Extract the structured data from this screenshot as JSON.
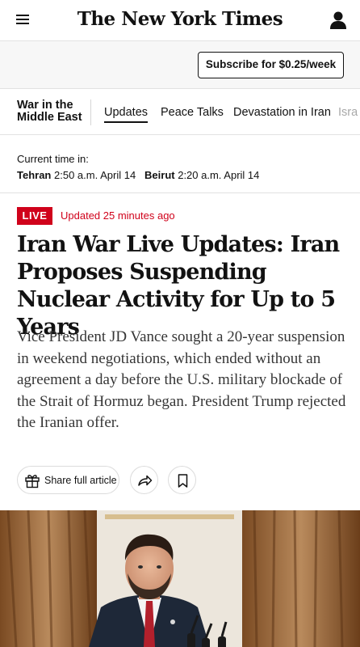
{
  "masthead": {
    "logo_text": "The New York Times",
    "menu_icon": "hamburger-menu-icon",
    "account_icon": "account-icon"
  },
  "subscribe": {
    "label": "Subscribe for $0.25/week"
  },
  "section_nav": {
    "section_title_line1": "War in the",
    "section_title_line2": "Middle East",
    "tabs": [
      {
        "label": "Updates",
        "active": true
      },
      {
        "label": "Peace Talks",
        "active": false
      },
      {
        "label": "Devastation in Iran",
        "active": false
      },
      {
        "label": "Isra",
        "active": false
      }
    ]
  },
  "current_time": {
    "label": "Current time in:",
    "city1": "Tehran",
    "time1": "2:50 a.m. April 14",
    "city2": "Beirut",
    "time2": "2:20 a.m. April 14"
  },
  "status": {
    "live_label": "LIVE",
    "updated": "Updated 25 minutes ago",
    "live_color": "#d0021b"
  },
  "article": {
    "headline": "Iran War Live Updates: Iran Proposes Suspending Nuclear Activity for Up to 5 Years",
    "summary": "Vice President JD Vance sought a 20-year suspension in weekend negotiations, which ended without an agreement a day before the U.S. military blockade of the Strait of Hormuz began. President Trump rejected the Iranian offer."
  },
  "actions": {
    "share_full_label": "Share full article",
    "gift_icon": "gift-icon",
    "share_icon": "share-arrow-icon",
    "bookmark_icon": "bookmark-icon"
  }
}
